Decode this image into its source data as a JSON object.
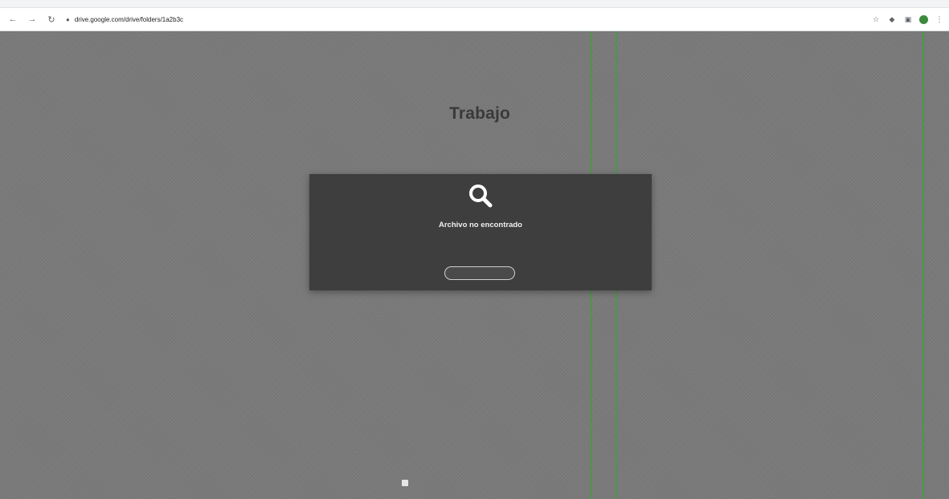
{
  "browser": {
    "url": "drive.google.com/drive/folders/1a2b3c",
    "back_icon": "arrow-left-icon",
    "forward_icon": "arrow-right-icon",
    "reload_icon": "reload-icon"
  },
  "page": {
    "brand": "Trabajo",
    "brand_sub": "",
    "card": {
      "icon": "search-icon",
      "title": "Archivo no encontrado",
      "message": "",
      "button": ""
    },
    "footer": ""
  },
  "colors": {
    "background": "#7a7a7a",
    "card": "#3e3e3e",
    "accent_line": "#3fa03a"
  }
}
